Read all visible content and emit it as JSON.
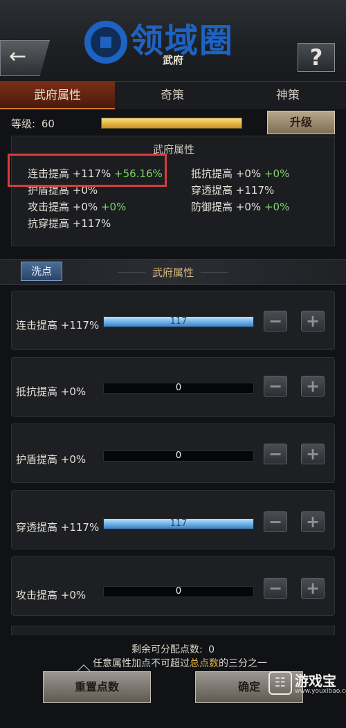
{
  "header": {
    "title": "武府",
    "back_icon": "back-arrow-icon",
    "help_label": "?",
    "logo_text": "领域圈"
  },
  "tabs": [
    {
      "label": "武府属性",
      "active": true
    },
    {
      "label": "奇策",
      "active": false
    },
    {
      "label": "神策",
      "active": false
    }
  ],
  "level": {
    "label": "等级:",
    "value": "60",
    "upgrade_label": "升级"
  },
  "attributes_panel": {
    "title": "武府属性",
    "items": [
      {
        "name": "连击提高",
        "base": "+117%",
        "bonus": "+56.16%"
      },
      {
        "name": "抵抗提高",
        "base": "+0%",
        "bonus": "+0%"
      },
      {
        "name": "护盾提高",
        "base": "+0%",
        "bonus": ""
      },
      {
        "name": "穿透提高",
        "base": "+117%",
        "bonus": ""
      },
      {
        "name": "攻击提高",
        "base": "+0%",
        "bonus": "+0%"
      },
      {
        "name": "防御提高",
        "base": "+0%",
        "bonus": "+0%"
      },
      {
        "name": "抗穿提高",
        "base": "+117%",
        "bonus": ""
      }
    ]
  },
  "section": {
    "wash_label": "洗点",
    "title": "武府属性"
  },
  "stats": [
    {
      "label": "连击提高 +117%",
      "value": "117",
      "fill": 1.0
    },
    {
      "label": "抵抗提高 +0%",
      "value": "0",
      "fill": 0
    },
    {
      "label": "护盾提高 +0%",
      "value": "0",
      "fill": 0
    },
    {
      "label": "穿透提高 +117%",
      "value": "117",
      "fill": 1.0
    },
    {
      "label": "攻击提高 +0%",
      "value": "0",
      "fill": 0
    }
  ],
  "stepper": {
    "minus": "−",
    "plus": "+"
  },
  "footer": {
    "remaining_label": "剩余可分配点数:",
    "remaining_value": "0",
    "note_prefix": "任意属性加点不可超过",
    "note_highlight": "总点数",
    "note_suffix": "的三分之一",
    "reset_label": "重置点数",
    "confirm_label": "确定"
  },
  "watermark": {
    "text": "游戏宝",
    "url": "www.youxibao.com"
  },
  "colors": {
    "accent_gold": "#e2b44a",
    "bonus_green": "#7ed36a",
    "highlight_red": "#d83c3c",
    "tab_active": "#7a2e17"
  }
}
